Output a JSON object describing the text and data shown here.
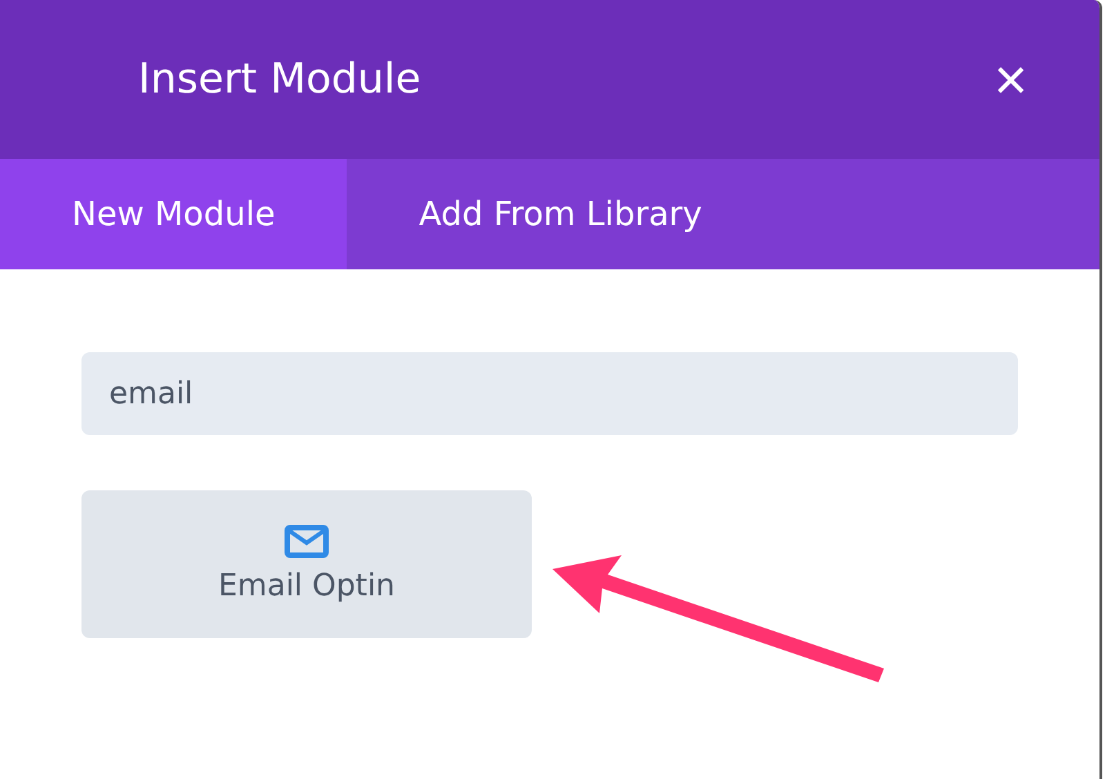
{
  "window": {
    "title": "Insert Module",
    "close_label": "×"
  },
  "tabs": [
    {
      "label": "New Module",
      "selected": true
    },
    {
      "label": "Add From Library",
      "selected": false
    }
  ],
  "search": {
    "value": "email"
  },
  "modules": [
    {
      "label": "Email Optin"
    }
  ]
}
